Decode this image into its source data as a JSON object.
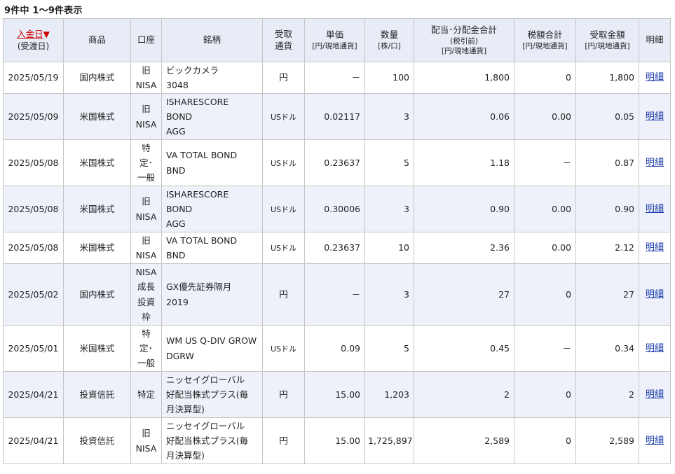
{
  "summary": "9件中 1～9件表示",
  "headers": {
    "date_label": "入金日",
    "date_arrow": "▼",
    "date_sub": "(受渡日)",
    "product": "商品",
    "account": "口座",
    "security": "銘柄",
    "currency_line1": "受取",
    "currency_line2": "通貨",
    "unit_price": "単価",
    "unit_price_sub": "[円/現地通貨]",
    "quantity": "数量",
    "quantity_sub": "[株/口]",
    "dividend": "配当･分配金合計",
    "dividend_sub1": "(税引前)",
    "dividend_sub2": "[円/現地通貨]",
    "tax": "税額合計",
    "tax_sub": "[円/現地通貨]",
    "received": "受取金額",
    "received_sub": "[円/現地通貨]",
    "detail": "明細"
  },
  "rows": [
    {
      "date": "2025/05/19",
      "product": "国内株式",
      "account": [
        "旧",
        "NISA"
      ],
      "security": [
        "ビックカメラ",
        "3048"
      ],
      "currency": "円",
      "price": "－",
      "qty": "100",
      "dividend": "1,800",
      "tax": "0",
      "received": "1,800",
      "detail": "明細"
    },
    {
      "date": "2025/05/09",
      "product": "米国株式",
      "account": [
        "旧",
        "NISA"
      ],
      "security": [
        "ISHARESCORE",
        "BOND",
        "AGG"
      ],
      "currency": "USドル",
      "price": "0.02117",
      "qty": "3",
      "dividend": "0.06",
      "tax": "0.00",
      "received": "0.05",
      "detail": "明細"
    },
    {
      "date": "2025/05/08",
      "product": "米国株式",
      "account": [
        "特",
        "定･",
        "一般"
      ],
      "security": [
        "VA TOTAL BOND",
        "BND"
      ],
      "currency": "USドル",
      "price": "0.23637",
      "qty": "5",
      "dividend": "1.18",
      "tax": "－",
      "received": "0.87",
      "detail": "明細"
    },
    {
      "date": "2025/05/08",
      "product": "米国株式",
      "account": [
        "旧",
        "NISA"
      ],
      "security": [
        "ISHARESCORE",
        "BOND",
        "AGG"
      ],
      "currency": "USドル",
      "price": "0.30006",
      "qty": "3",
      "dividend": "0.90",
      "tax": "0.00",
      "received": "0.90",
      "detail": "明細"
    },
    {
      "date": "2025/05/08",
      "product": "米国株式",
      "account": [
        "旧",
        "NISA"
      ],
      "security": [
        "VA TOTAL BOND",
        "BND"
      ],
      "currency": "USドル",
      "price": "0.23637",
      "qty": "10",
      "dividend": "2.36",
      "tax": "0.00",
      "received": "2.12",
      "detail": "明細"
    },
    {
      "date": "2025/05/02",
      "product": "国内株式",
      "account": [
        "NISA",
        "成長",
        "投資",
        "枠"
      ],
      "security": [
        "GX優先証券隔月",
        "2019"
      ],
      "currency": "円",
      "price": "－",
      "qty": "3",
      "dividend": "27",
      "tax": "0",
      "received": "27",
      "detail": "明細"
    },
    {
      "date": "2025/05/01",
      "product": "米国株式",
      "account": [
        "特",
        "定･",
        "一般"
      ],
      "security": [
        "WM US Q-DIV GROW",
        "DGRW"
      ],
      "currency": "USドル",
      "price": "0.09",
      "qty": "5",
      "dividend": "0.45",
      "tax": "－",
      "received": "0.34",
      "detail": "明細"
    },
    {
      "date": "2025/04/21",
      "product": "投資信託",
      "account": [
        "特定"
      ],
      "security": [
        "ニッセイグローバル",
        "好配当株式プラス(毎",
        "月決算型)"
      ],
      "currency": "円",
      "price": "15.00",
      "qty": "1,203",
      "dividend": "2",
      "tax": "0",
      "received": "2",
      "detail": "明細"
    },
    {
      "date": "2025/04/21",
      "product": "投資信託",
      "account": [
        "旧",
        "NISA"
      ],
      "security": [
        "ニッセイグローバル",
        "好配当株式プラス(毎",
        "月決算型)"
      ],
      "currency": "円",
      "price": "15.00",
      "qty": "1,725,897",
      "dividend": "2,589",
      "tax": "0",
      "received": "2,589",
      "detail": "明細"
    }
  ]
}
